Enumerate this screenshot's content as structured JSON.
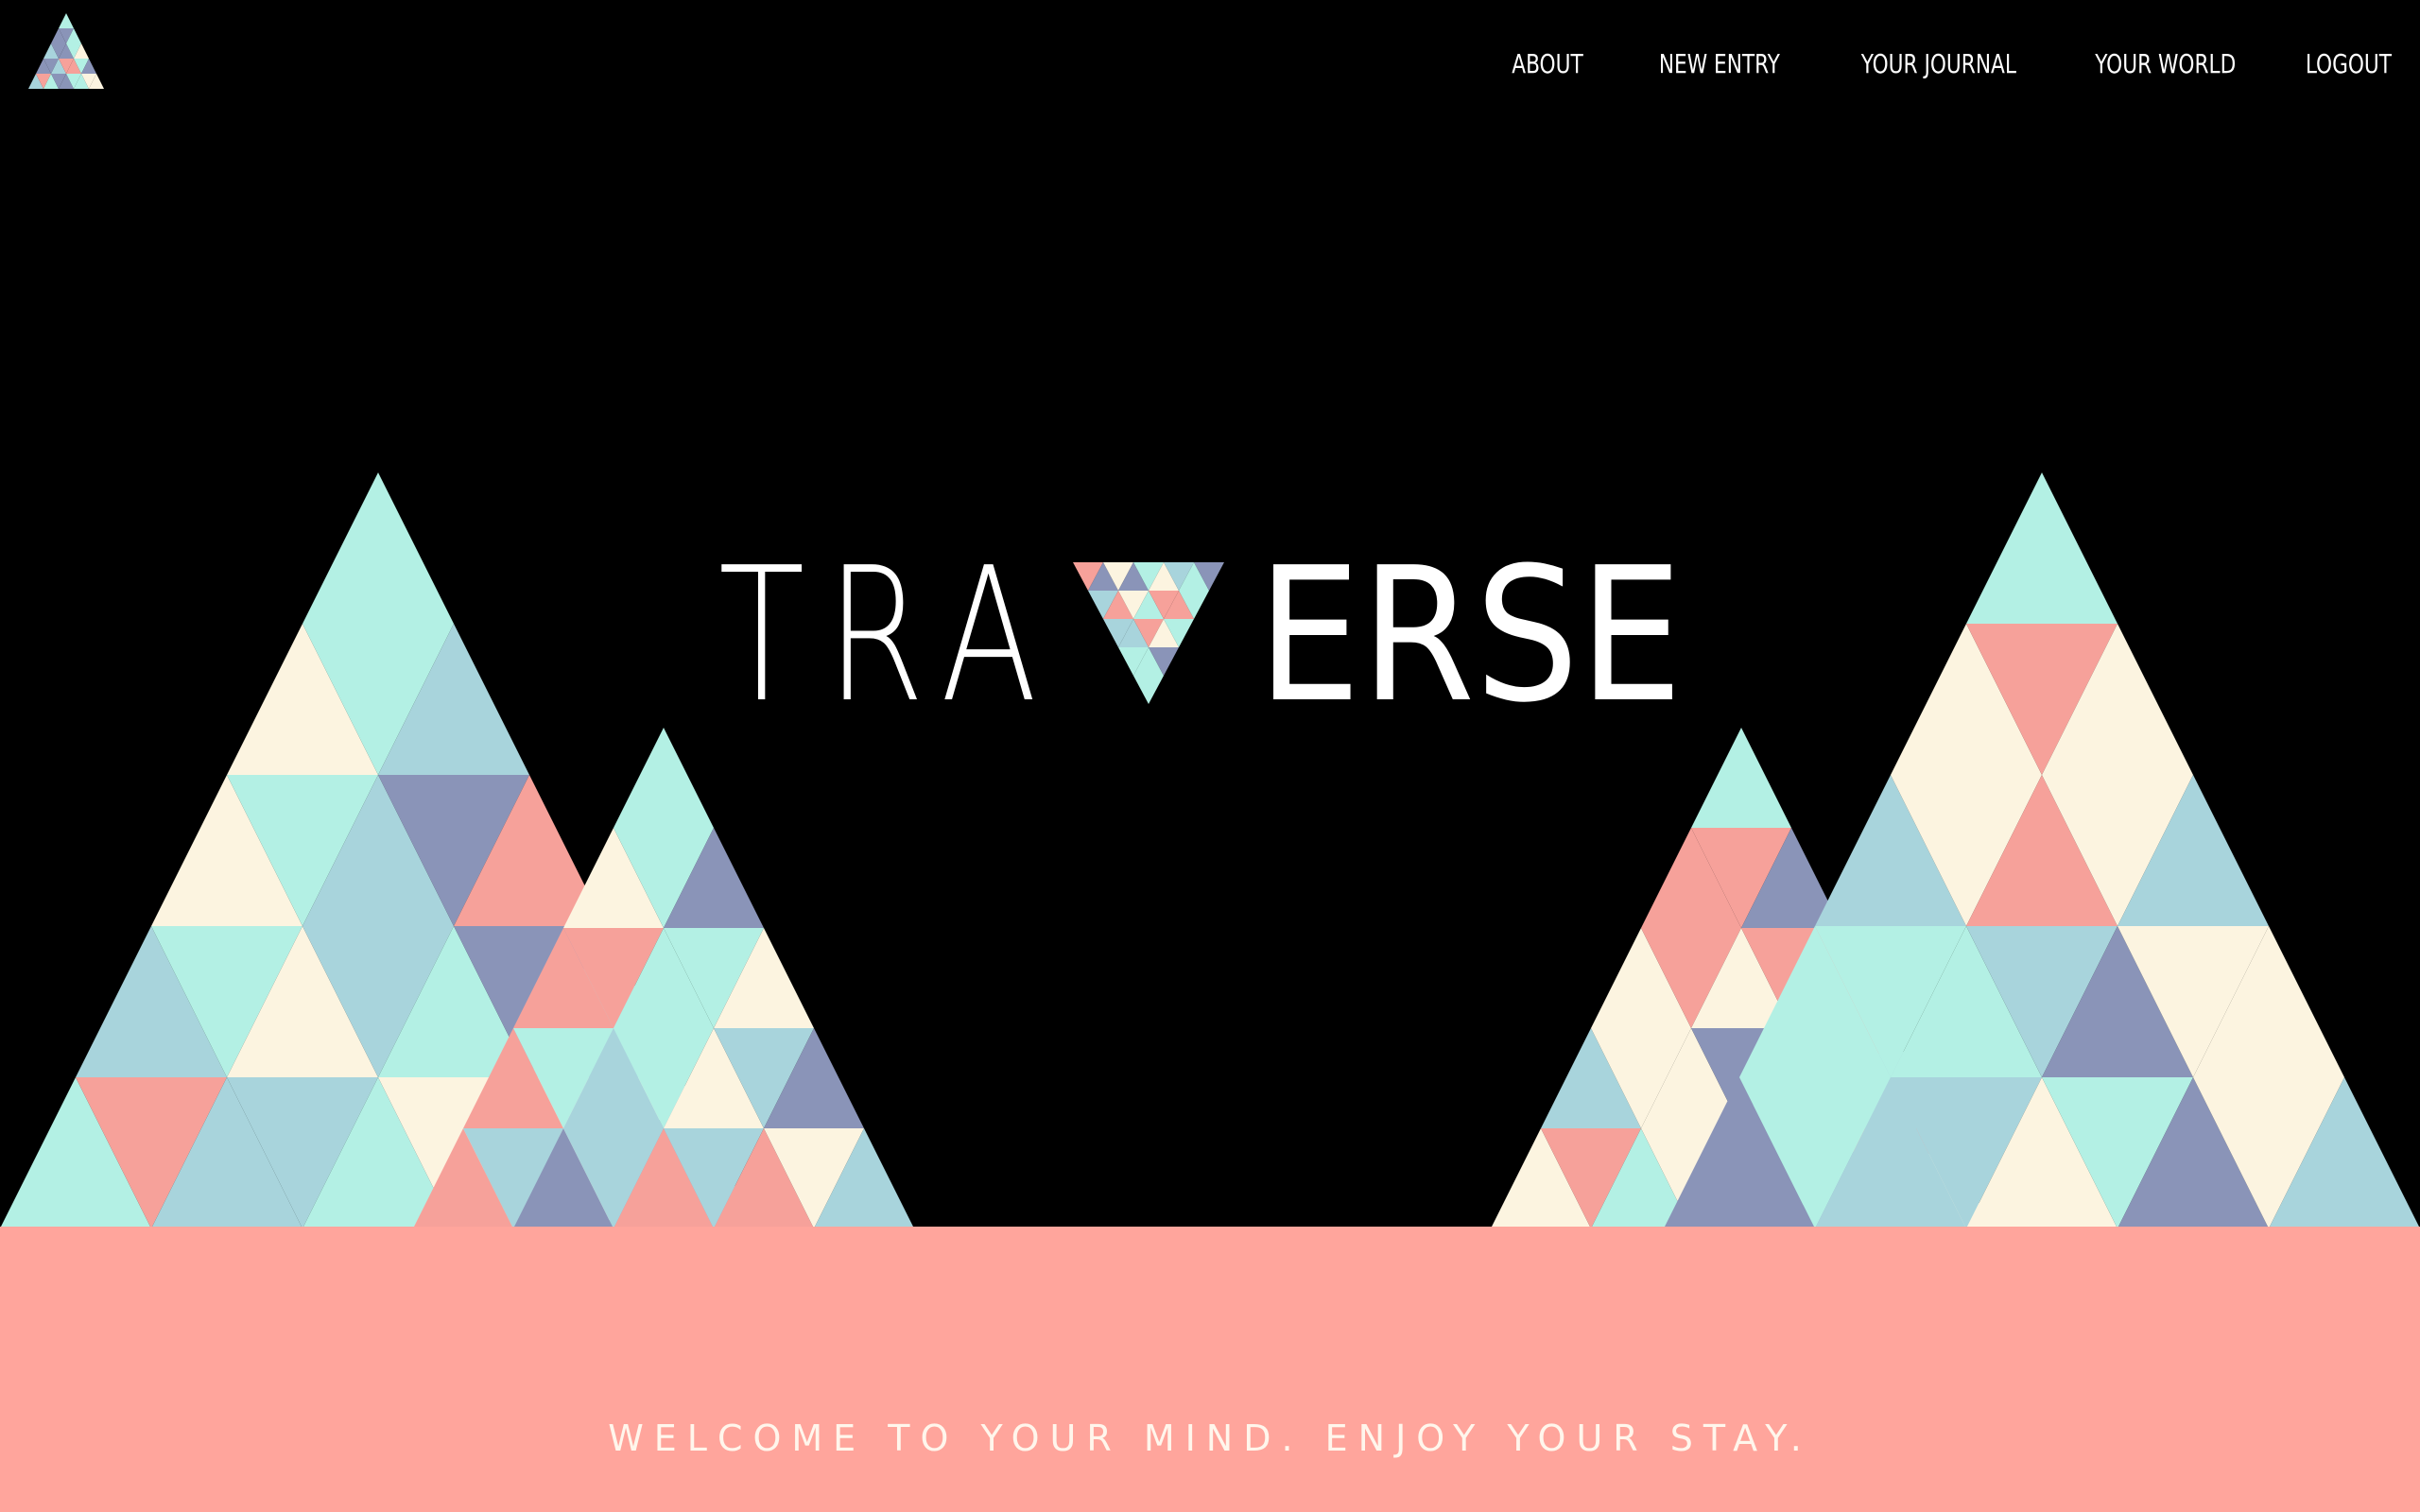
{
  "logo": {
    "name": "traverse-logo-icon"
  },
  "nav": {
    "items": [
      {
        "id": "about",
        "label": "ABOUT"
      },
      {
        "id": "new-entry",
        "label": "NEW ENTRY"
      },
      {
        "id": "your-journal",
        "label": "YOUR JOURNAL"
      },
      {
        "id": "your-world",
        "label": "YOUR WORLD"
      },
      {
        "id": "logout",
        "label": "LOGOUT"
      }
    ]
  },
  "hero": {
    "title_left": "TRA",
    "title_right": "ERSE"
  },
  "footer": {
    "tagline": "WELCOME TO YOUR MIND. ENJOY YOUR STAY."
  },
  "colors": {
    "background": "#000000",
    "footer_band": "#ffa59c",
    "mint": "#b3f0e4",
    "light_blue": "#a8d4dc",
    "slate": "#8a94b8",
    "coral": "#f6a19a",
    "cream": "#fcf4e0"
  }
}
